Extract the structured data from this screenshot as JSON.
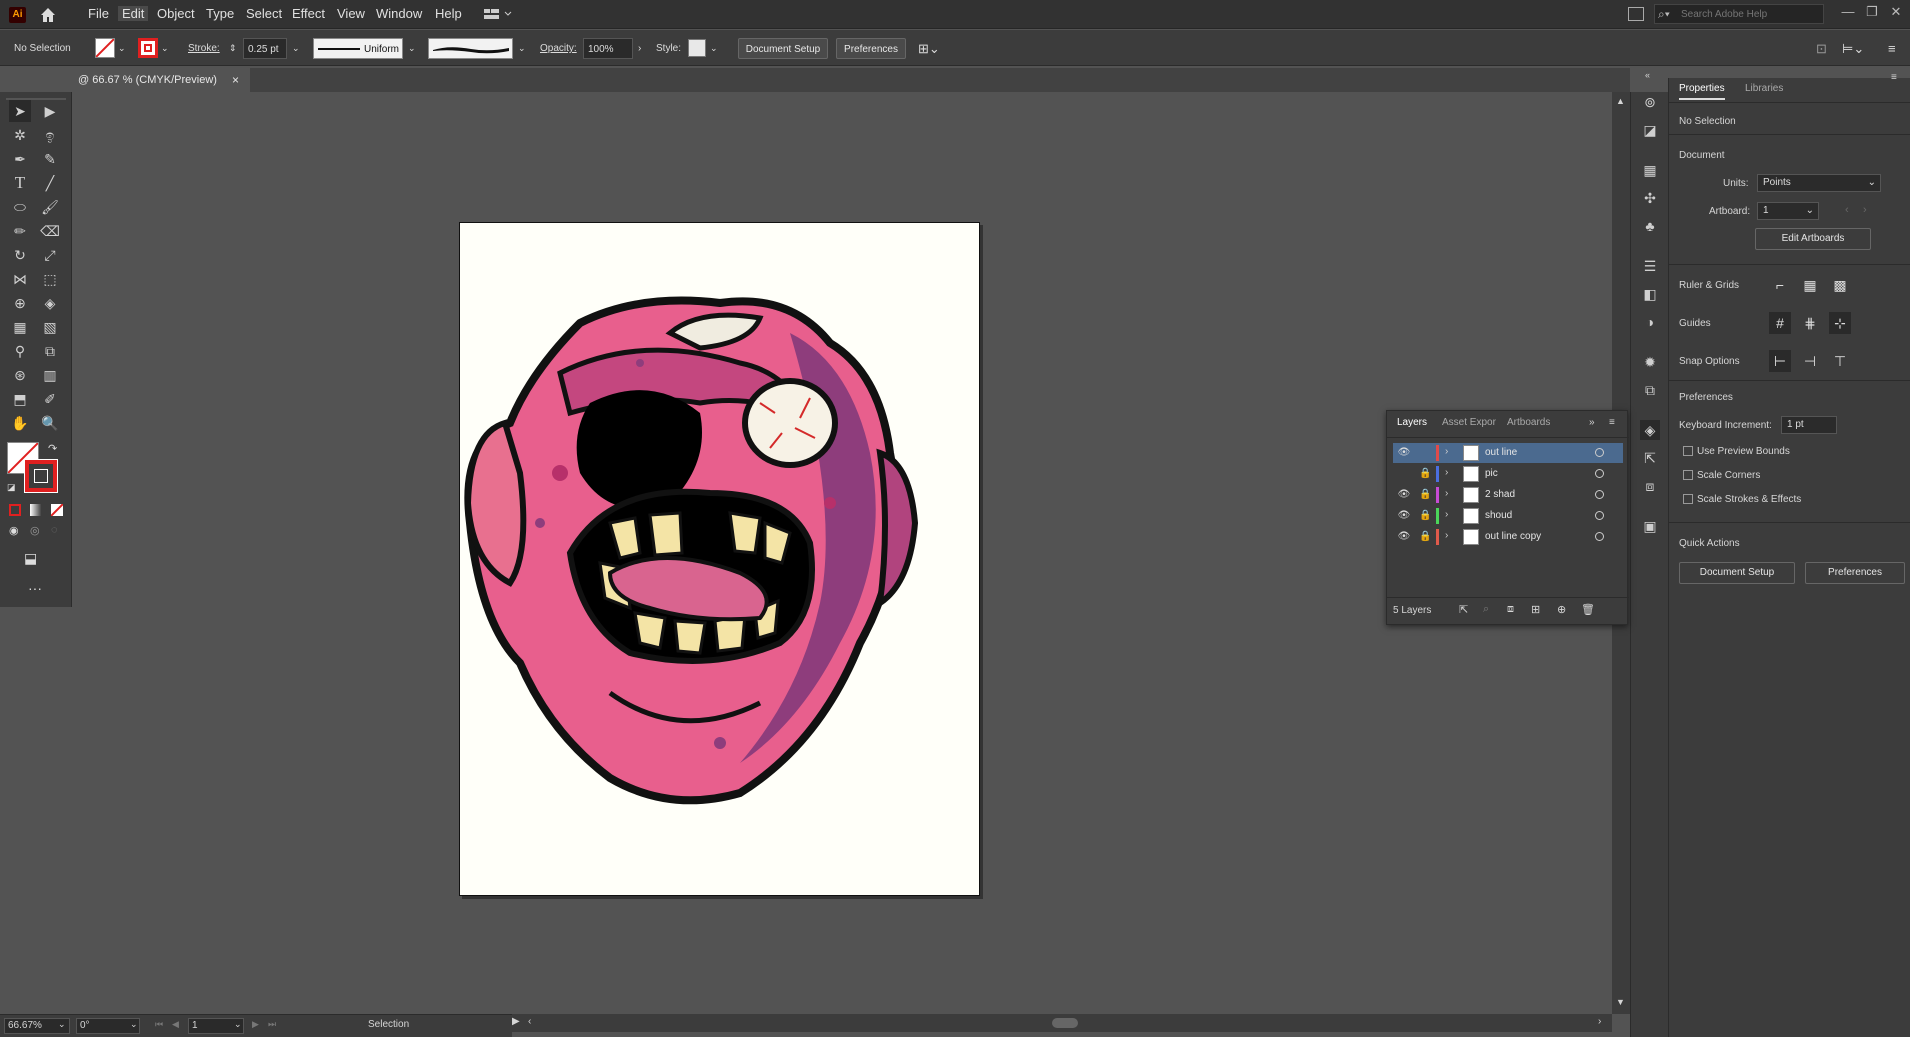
{
  "app": {
    "logo": "Ai",
    "home_icon": "home-icon"
  },
  "menu": [
    "File",
    "Edit",
    "Object",
    "Type",
    "Select",
    "Effect",
    "View",
    "Window",
    "Help"
  ],
  "search": {
    "placeholder": "Search Adobe Help"
  },
  "control": {
    "selection": "No Selection",
    "stroke_label": "Stroke:",
    "stroke_value": "0.25 pt",
    "profile": "Uniform",
    "opacity_label": "Opacity:",
    "opacity_value": "100%",
    "style_label": "Style:",
    "doc_setup": "Document Setup",
    "preferences": "Preferences"
  },
  "doc_tab": {
    "title": "@ 66.67 % (CMYK/Preview)",
    "close": "×"
  },
  "status": {
    "zoom": "66.67%",
    "rotation": "0°",
    "artboard": "1",
    "tool": "Selection"
  },
  "properties": {
    "tabs": [
      "Properties",
      "Libraries"
    ],
    "selection": "No Selection",
    "document_heading": "Document",
    "units_label": "Units:",
    "units_value": "Points",
    "artboard_label": "Artboard:",
    "artboard_value": "1",
    "edit_artboards": "Edit Artboards",
    "ruler_grids": "Ruler & Grids",
    "guides": "Guides",
    "snap_options": "Snap Options",
    "preferences_heading": "Preferences",
    "keyboard_increment_label": "Keyboard Increment:",
    "keyboard_increment_value": "1 pt",
    "use_preview_bounds": "Use Preview Bounds",
    "scale_corners": "Scale Corners",
    "scale_strokes": "Scale Strokes & Effects",
    "quick_actions": "Quick Actions",
    "qa_doc_setup": "Document Setup",
    "qa_preferences": "Preferences"
  },
  "layers_panel": {
    "tabs": [
      "Layers",
      "Asset Expor",
      "Artboards"
    ],
    "count": "5 Layers",
    "layers": [
      {
        "name": "out line",
        "color": "#e04b4b",
        "visible": true,
        "locked": false,
        "selected": true
      },
      {
        "name": "pic",
        "color": "#4b6fe0",
        "visible": false,
        "locked": true,
        "selected": false
      },
      {
        "name": "2 shad",
        "color": "#c84bd6",
        "visible": true,
        "locked": true,
        "selected": false
      },
      {
        "name": "shoud",
        "color": "#4bd65a",
        "visible": true,
        "locked": true,
        "selected": false
      },
      {
        "name": "out line copy",
        "color": "#e05a4b",
        "visible": true,
        "locked": true,
        "selected": false
      }
    ]
  },
  "colors": {
    "accent": "#e02020",
    "panel": "#3c3c3c",
    "canvas": "#535353"
  }
}
